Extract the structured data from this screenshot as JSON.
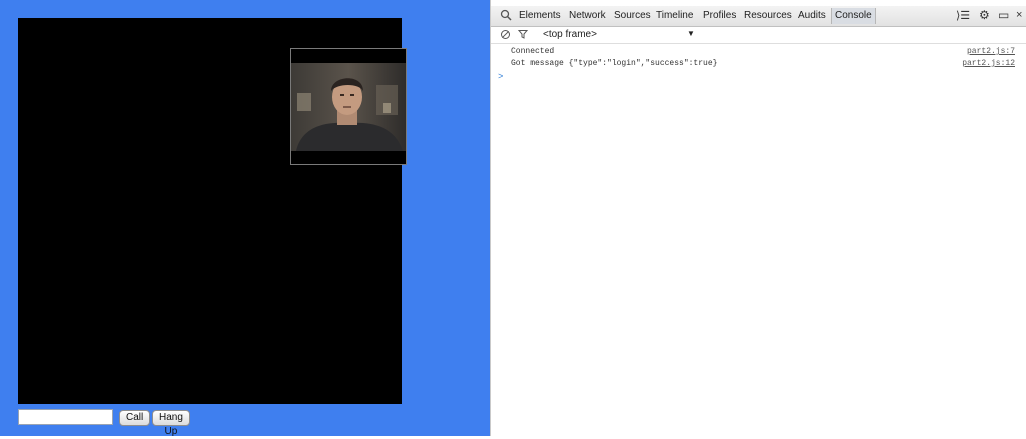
{
  "app": {
    "call_button": "Call",
    "hangup_button": "Hang Up",
    "username_input": {
      "value": "",
      "placeholder": ""
    }
  },
  "devtools": {
    "tabs": [
      "Elements",
      "Network",
      "Sources",
      "Timeline",
      "Profiles",
      "Resources",
      "Audits",
      "Console"
    ],
    "active_tab": "Console",
    "frame_selector": "<top frame>",
    "frame_arrow": "▼",
    "toolbar_icons": [
      "search-icon",
      "console-drawer-icon",
      "gear-icon",
      "dock-icon",
      "close-icon"
    ],
    "toolbar_glyphs": {
      "drawer": "⟩☰",
      "gear": "⚙",
      "dock": "▭",
      "close": "×"
    },
    "console_lines": [
      {
        "message": "Connected",
        "source": "part2.js:7"
      },
      {
        "message": "Got message {\"type\":\"login\",\"success\":true}",
        "source": "part2.js:12"
      }
    ],
    "prompt": ">"
  },
  "colors": {
    "page_background": "#3f7fef",
    "video_background": "#000000",
    "prompt": "#2b7bd6"
  }
}
